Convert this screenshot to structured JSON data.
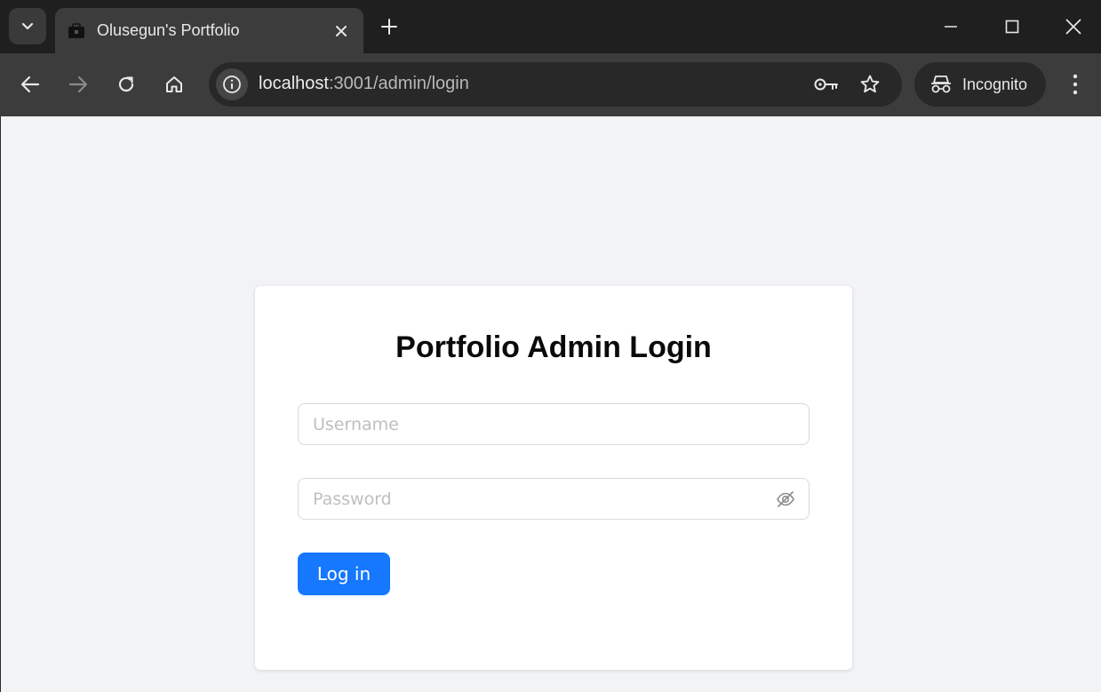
{
  "browser": {
    "tab": {
      "title": "Olusegun's Portfolio"
    },
    "address_bar": {
      "host": "localhost",
      "path": ":3001/admin/login"
    },
    "profile": {
      "label": "Incognito"
    },
    "icons": {
      "tab_menu": "chevron-down-icon",
      "favicon": "briefcase-icon",
      "tab_close": "close-icon",
      "new_tab": "plus-icon",
      "minimize": "minimize-icon",
      "maximize": "maximize-icon",
      "close_window": "close-icon",
      "back": "arrow-left-icon",
      "forward": "arrow-right-icon",
      "reload": "reload-icon",
      "home": "home-icon",
      "site_info": "info-icon",
      "password_key": "key-icon",
      "bookmark": "star-icon",
      "incognito": "incognito-icon",
      "menu": "kebab-menu-icon"
    }
  },
  "login": {
    "title": "Portfolio Admin Login",
    "username_placeholder": "Username",
    "username_value": "",
    "password_placeholder": "Password",
    "password_value": "",
    "submit_label": "Log in",
    "icons": {
      "password_visibility": "eye-off-icon"
    }
  },
  "colors": {
    "primary": "#1677ff",
    "page_background": "#f2f3f5",
    "chrome_dark": "#1f1f1f",
    "chrome_toolbar": "#3c3c3c"
  }
}
